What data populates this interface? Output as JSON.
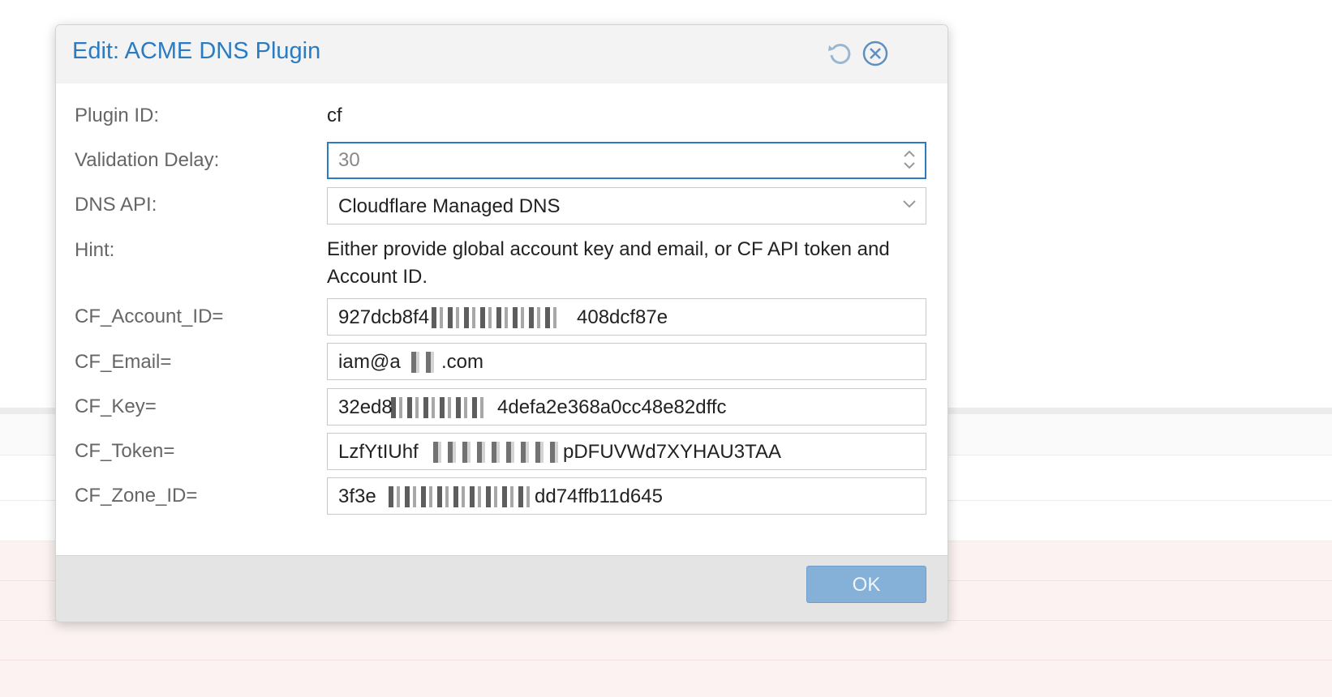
{
  "dialog": {
    "title": "Edit: ACME DNS Plugin",
    "reset_icon": "reset-icon",
    "close_icon": "close-icon"
  },
  "form": {
    "plugin_id": {
      "label": "Plugin ID:",
      "value": "cf"
    },
    "validation_delay": {
      "label": "Validation Delay:",
      "value": "30"
    },
    "dns_api": {
      "label": "DNS API:",
      "value": "Cloudflare Managed DNS"
    },
    "hint": {
      "label": "Hint:",
      "text": "Either provide global account key and email, or CF API token and Account ID."
    },
    "fields": [
      {
        "label": "CF_Account_ID=",
        "prefix": "927dcb8f4",
        "suffix": "408dcf87e"
      },
      {
        "label": "CF_Email=",
        "prefix": "ia",
        "middle": "m@a",
        "suffix": ".com"
      },
      {
        "label": "CF_Key=",
        "prefix": "32ed8",
        "suffix": "4defa2e368a0cc48e82dffc"
      },
      {
        "label": "CF_Token=",
        "prefix": "LzfYtIUhf",
        "suffix": "pDFUVWd7XYHAU3TAA"
      },
      {
        "label": "CF_Zone_ID=",
        "prefix": "3f3e",
        "suffix": "dd74ffb11d645"
      }
    ]
  },
  "footer": {
    "ok_label": "OK"
  },
  "colors": {
    "accent": "#2a7bc2",
    "ok_button": "#85b1d9",
    "header_bg": "#f3f3f3",
    "footer_bg": "#e4e4e4"
  }
}
